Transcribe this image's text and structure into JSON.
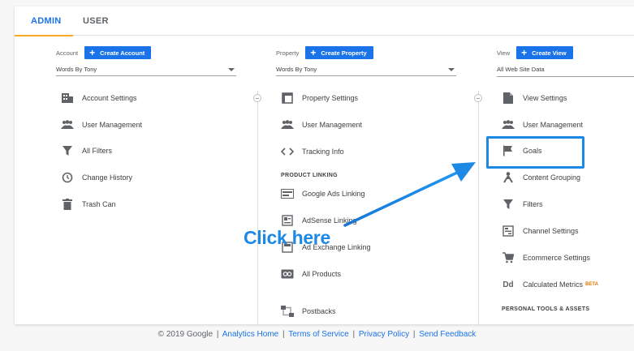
{
  "tabs": {
    "admin": "ADMIN",
    "user": "USER"
  },
  "account": {
    "label": "Account",
    "create_label": "Create Account",
    "selected": "Words By Tony",
    "items": [
      {
        "label": "Account Settings",
        "icon": "building-icon"
      },
      {
        "label": "User Management",
        "icon": "users-icon"
      },
      {
        "label": "All Filters",
        "icon": "filter-icon"
      },
      {
        "label": "Change History",
        "icon": "history-icon"
      },
      {
        "label": "Trash Can",
        "icon": "trash-icon"
      }
    ]
  },
  "property": {
    "label": "Property",
    "create_label": "Create Property",
    "selected": "Words By Tony",
    "items": [
      {
        "label": "Property Settings",
        "icon": "window-icon"
      },
      {
        "label": "User Management",
        "icon": "users-icon"
      },
      {
        "label": "Tracking Info",
        "icon": "code-icon"
      }
    ],
    "section_title": "PRODUCT LINKING",
    "linking": [
      {
        "label": "Google Ads Linking",
        "icon": "ads-icon"
      },
      {
        "label": "AdSense Linking",
        "icon": "adsense-icon"
      },
      {
        "label": "Ad Exchange Linking",
        "icon": "adexchange-icon"
      },
      {
        "label": "All Products",
        "icon": "link-icon"
      },
      {
        "label": "Postbacks",
        "icon": "postback-icon"
      }
    ]
  },
  "view": {
    "label": "View",
    "create_label": "Create View",
    "selected": "All Web Site Data",
    "items": [
      {
        "label": "View Settings",
        "icon": "document-icon"
      },
      {
        "label": "User Management",
        "icon": "users-icon"
      },
      {
        "label": "Goals",
        "icon": "flag-icon"
      },
      {
        "label": "Content Grouping",
        "icon": "person-icon"
      },
      {
        "label": "Filters",
        "icon": "filter-icon"
      },
      {
        "label": "Channel Settings",
        "icon": "channel-icon"
      },
      {
        "label": "Ecommerce Settings",
        "icon": "cart-icon"
      },
      {
        "label": "Calculated Metrics",
        "icon": "dd-icon",
        "badge": "BETA"
      }
    ],
    "section_title": "PERSONAL TOOLS & ASSETS"
  },
  "annotation": {
    "text": "Click here"
  },
  "footer": {
    "copyright": "© 2019 Google",
    "links": [
      "Analytics Home",
      "Terms of Service",
      "Privacy Policy",
      "Send Feedback"
    ]
  },
  "colors": {
    "accent": "#1a73e8",
    "highlight": "#1e88e5",
    "tab_underline": "#f9a825",
    "icon": "#5f6368"
  }
}
